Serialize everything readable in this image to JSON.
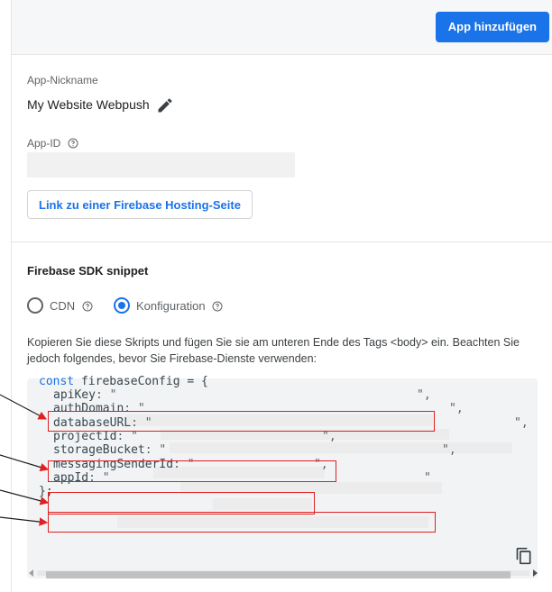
{
  "header": {
    "add_app_label": "App hinzufügen"
  },
  "app": {
    "nickname_label": "App-Nickname",
    "nickname_value": "My Website Webpush",
    "appid_label": "App-ID",
    "hosting_link_label": "Link zu einer Firebase Hosting-Seite"
  },
  "sdk": {
    "title": "Firebase SDK snippet",
    "options": [
      {
        "label": "CDN",
        "selected": false
      },
      {
        "label": "Konfiguration",
        "selected": true
      }
    ],
    "description": "Kopieren Sie diese Skripts und fügen Sie sie am unteren Ende des Tags <body> ein. Beachten Sie jedoch folgendes, bevor Sie Firebase-Dienste verwenden:"
  },
  "code": {
    "line1_kw": "const",
    "line1_rest": " firebaseConfig = {",
    "keys": [
      "apiKey",
      "authDomain",
      "databaseURL",
      "projectId",
      "storageBucket",
      "messagingSenderId",
      "appId"
    ],
    "closing": "};"
  },
  "icons": {
    "edit": "pencil-icon",
    "help": "help-circle-icon",
    "copy": "copy-icon"
  },
  "colors": {
    "primary": "#1a73e8",
    "annotation": "#e02020"
  }
}
